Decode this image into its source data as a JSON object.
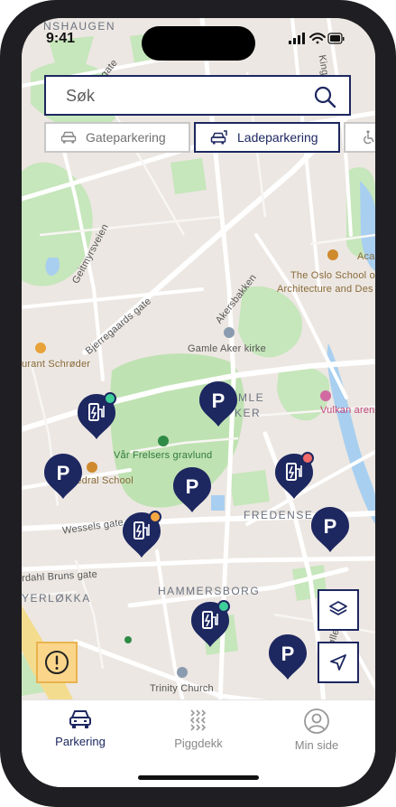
{
  "status_bar": {
    "time": "9:41"
  },
  "search": {
    "placeholder": "Søk"
  },
  "filters": [
    {
      "label": "Gateparkering",
      "icon": "car-icon",
      "active": false
    },
    {
      "label": "Ladeparkering",
      "icon": "ev-car-icon",
      "active": true
    },
    {
      "label": "",
      "icon": "wheelchair-icon",
      "active": false
    }
  ],
  "map": {
    "labels": {
      "nshaugen": "NSHAUGEN",
      "gate_top": "gate",
      "kingos": "Kingos",
      "geitmyrsveien": "Geitmyrsveien",
      "bjerregaards": "Bjerregaards gate",
      "akersbakken": "Akersbakken",
      "oslo_school_1": "The Oslo School of",
      "oslo_school_2": "Architecture and Des",
      "aca": "Aca",
      "gamle_aker_kirke": "Gamle Aker kirke",
      "restaurant": "urant Schrøder",
      "gamle_1": "MLE",
      "gamle_2": "KER",
      "vulkan": "Vulkan arena",
      "var_frelsers": "Vår Frelsers gravlund",
      "cathedral": "hedral School",
      "wessels": "Wessels gate",
      "fredensborg": "FREDENSE",
      "bruns": "rdahl Bruns gate",
      "hammersborg": "HAMMERSBORG",
      "yerlokka": "YERLØKKA",
      "mollerga": "Møllerga",
      "trinity": "Trinity Church",
      "ha": "HA"
    }
  },
  "pins": [
    {
      "type": "ev",
      "status_color": "#3ecf9a"
    },
    {
      "type": "parking",
      "label": "P"
    },
    {
      "type": "parking",
      "label": "P"
    },
    {
      "type": "parking",
      "label": "P"
    },
    {
      "type": "ev",
      "status_color": "#f06a6a"
    },
    {
      "type": "ev",
      "status_color": "#f5a742"
    },
    {
      "type": "parking",
      "label": "P"
    },
    {
      "type": "ev",
      "status_color": "#3ecf9a"
    },
    {
      "type": "parking",
      "label": "P"
    }
  ],
  "map_controls": {
    "layers": "layers-icon",
    "locate": "navigation-arrow-icon",
    "alert": "alert-circle-icon"
  },
  "tabs": [
    {
      "label": "Parkering",
      "icon": "car-icon",
      "active": true
    },
    {
      "label": "Piggdekk",
      "icon": "tire-tread-icon",
      "active": false
    },
    {
      "label": "Min side",
      "icon": "user-icon",
      "active": false
    }
  ],
  "colors": {
    "brand_navy": "#1d2760",
    "map_bg": "#ece7e2",
    "park_green": "#bfe2b2",
    "road": "#ffffff",
    "warning": "#fbd58a"
  }
}
